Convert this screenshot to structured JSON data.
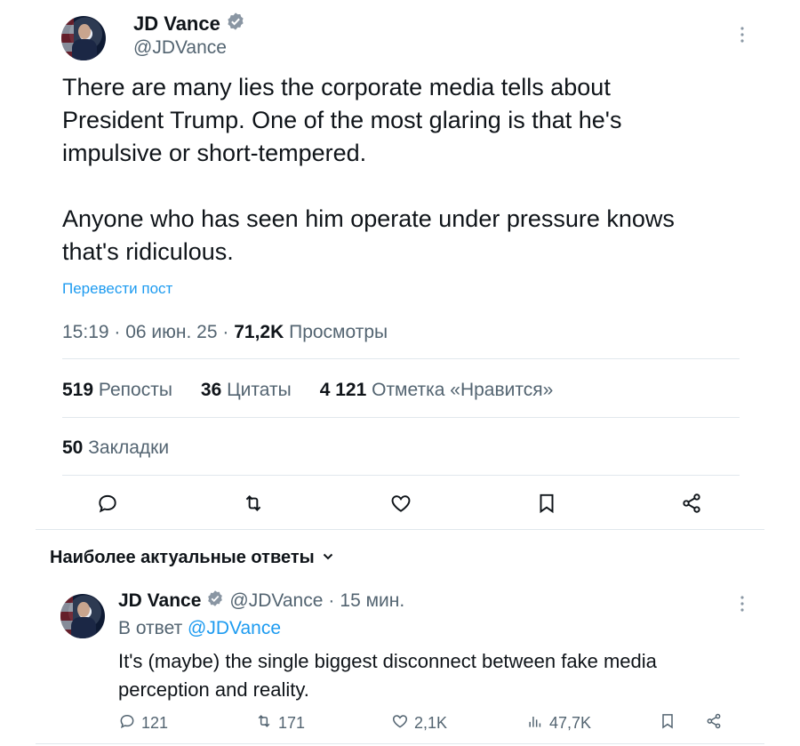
{
  "tweet": {
    "author_name": "JD Vance",
    "author_handle": "@JDVance",
    "text": "There are many lies the corporate media tells about\nPresident Trump. One of the most glaring is that he's\nimpulsive or short-tempered.\n\nAnyone who has seen him operate under pressure knows\nthat's ridiculous.",
    "translate_label": "Перевести пост",
    "time": "15:19",
    "date": "06 июн. 25",
    "views_count": "71,2K",
    "views_label": "Просмотры",
    "reposts_count": "519",
    "reposts_label": "Репосты",
    "quotes_count": "36",
    "quotes_label": "Цитаты",
    "likes_count": "4 121",
    "likes_label": "Отметка «Нравится»",
    "bookmarks_count": "50",
    "bookmarks_label": "Закладки",
    "actions": [
      "reply-icon",
      "retweet-icon",
      "like-icon",
      "bookmark-icon",
      "share-icon"
    ]
  },
  "replies_sort": {
    "label": "Наиболее актуальные ответы"
  },
  "reply": {
    "author_name": "JD Vance",
    "author_handle": "@JDVance",
    "time_ago": "15 мин.",
    "in_reply_prefix": "В ответ",
    "in_reply_handle": "@JDVance",
    "text": "It's (maybe) the single biggest disconnect between fake media perception and reality.",
    "replies": "121",
    "retweets": "171",
    "likes": "2,1K",
    "views": "47,7K"
  },
  "colors": {
    "accent": "#1d9bf0",
    "text": "#0f1419",
    "secondary": "#536471",
    "divider": "#e1e8ed"
  }
}
